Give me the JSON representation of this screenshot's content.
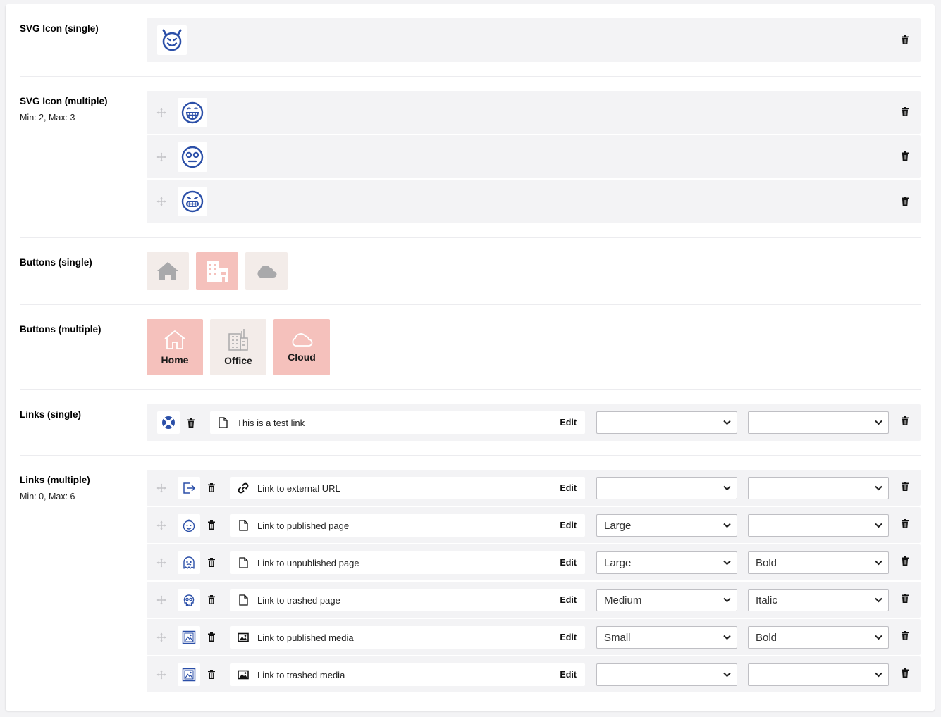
{
  "properties": {
    "svg_single": {
      "label": "SVG Icon (single)",
      "icon": "devil-smiley-icon"
    },
    "svg_multiple": {
      "label": "SVG Icon (multiple)",
      "description": "Min: 2, Max: 3",
      "icons": [
        "grin-icon",
        "sleepy-face-icon",
        "grimace-icon"
      ]
    },
    "buttons_single": {
      "label": "Buttons (single)",
      "items": [
        {
          "icon": "home-icon",
          "selected": false
        },
        {
          "icon": "office-icon",
          "selected": true
        },
        {
          "icon": "cloud-icon",
          "selected": false
        }
      ]
    },
    "buttons_multiple": {
      "label": "Buttons (multiple)",
      "items": [
        {
          "icon": "home-outline-icon",
          "label": "Home",
          "selected": true
        },
        {
          "icon": "office-outline-icon",
          "label": "Office",
          "selected": false
        },
        {
          "icon": "cloud-outline-icon",
          "label": "Cloud",
          "selected": true
        }
      ]
    },
    "links_single": {
      "label": "Links (single)",
      "row": {
        "icon": "lifebuoy-icon",
        "text": "This is a test link",
        "edit": "Edit",
        "size": "",
        "style": ""
      }
    },
    "links_multiple": {
      "label": "Links (multiple)",
      "description": "Min: 0, Max: 6",
      "rows": [
        {
          "icon": "sign-out-icon",
          "type_icon": "link-icon",
          "text": "Link to external URL",
          "edit": "Edit",
          "size": "",
          "style": ""
        },
        {
          "icon": "baby-icon",
          "type_icon": "page-icon",
          "text": "Link to published page",
          "edit": "Edit",
          "size": "Large",
          "style": ""
        },
        {
          "icon": "ghost-icon",
          "type_icon": "page-icon",
          "text": "Link to unpublished page",
          "edit": "Edit",
          "size": "Large",
          "style": "Bold"
        },
        {
          "icon": "skull-icon",
          "type_icon": "page-icon",
          "text": "Link to trashed page",
          "edit": "Edit",
          "size": "Medium",
          "style": "Italic"
        },
        {
          "icon": "picture-icon",
          "type_icon": "image-icon",
          "text": "Link to published media",
          "edit": "Edit",
          "size": "Small",
          "style": "Bold"
        },
        {
          "icon": "picture-icon",
          "type_icon": "image-icon",
          "text": "Link to trashed media",
          "edit": "Edit",
          "size": "",
          "style": ""
        }
      ]
    }
  },
  "colors": {
    "icon_blue": "#2b4fa8",
    "button_selected": "#f5c1bc",
    "button_default": "#f3ece9",
    "row_bg": "#f3f3f5"
  }
}
